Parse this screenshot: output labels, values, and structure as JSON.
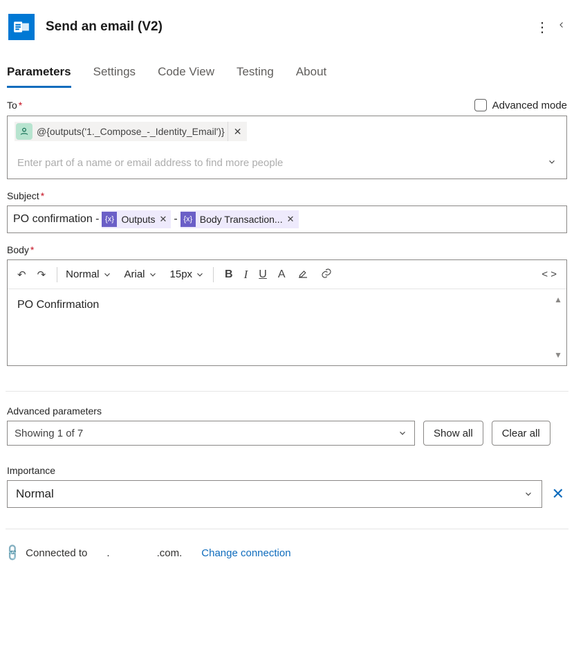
{
  "header": {
    "title": "Send an email (V2)"
  },
  "tabs": [
    "Parameters",
    "Settings",
    "Code View",
    "Testing",
    "About"
  ],
  "advanced_mode_label": "Advanced mode",
  "to": {
    "label": "To",
    "chip": "@{outputs('1._Compose_-_Identity_Email')}",
    "placeholder": "Enter part of a name or email address to find more people"
  },
  "subject": {
    "label": "Subject",
    "text_before": "PO confirmation - ",
    "token1": "Outputs",
    "sep": " - ",
    "token2": "Body Transaction..."
  },
  "body": {
    "label": "Body",
    "toolbar": {
      "style": "Normal",
      "font": "Arial",
      "size": "15px"
    },
    "content": "PO Confirmation"
  },
  "advanced": {
    "label": "Advanced parameters",
    "showing": "Showing 1 of 7",
    "show_all": "Show all",
    "clear_all": "Clear all"
  },
  "importance": {
    "label": "Importance",
    "value": "Normal"
  },
  "connection": {
    "connected_to": "Connected to",
    "domain": ".com.",
    "change": "Change connection"
  }
}
